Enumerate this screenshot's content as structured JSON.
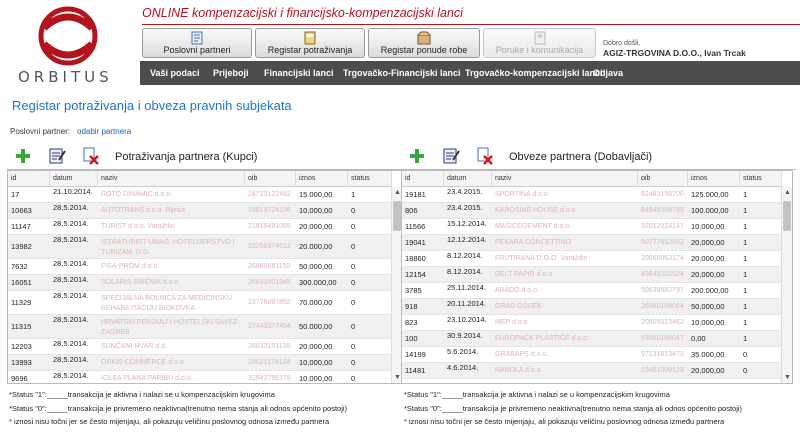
{
  "brand": {
    "logo_text": "ORBITUS",
    "logo_color": "#b3131c"
  },
  "app_title": "ONLINE kompenzacijski i financijsko-kompenzacijski lanci",
  "top_buttons": [
    {
      "label": "Poslovni partneri"
    },
    {
      "label": "Registar potraživanja"
    },
    {
      "label": "Registar ponude robe"
    },
    {
      "label": "Poruke i komunikacija"
    }
  ],
  "welcome": "Dobro došli,",
  "user": "AGIZ-TRGOVINA D.O.O., Ivan Trcak",
  "nav": [
    "Vaši podaci",
    "Prijeboji",
    "Financijski lanci",
    "Trgovačko-Financijski lanci",
    "Trgovačko-kompenzacijski lanci",
    "Odjava"
  ],
  "page_title": "Registar potraživanja i obveza pravnih subjekata",
  "partner": {
    "label": "Poslovni partner:",
    "link": "odabir partnera"
  },
  "columns": {
    "id": "id",
    "datum": "datum",
    "naziv": "naziv",
    "oib": "oib",
    "iznos": "iznos",
    "status": "status"
  },
  "left_panel": {
    "title": "Potraživanja partnera (Kupci)",
    "rows": [
      {
        "id": "17",
        "datum": "21.10.2014.",
        "naziv": "ROTO DINAMIC d.o.o.",
        "oib": "24723122482",
        "iznos": "15.000,00",
        "status": "1"
      },
      {
        "id": "10663",
        "datum": "28.5.2014.",
        "naziv": "AUTOTRANS d.o.o. Rijeka",
        "oib": "19819724156",
        "iznos": "10.000,00",
        "status": "0"
      },
      {
        "id": "11147",
        "datum": "28.5.2014.",
        "naziv": "TURIST d.o.o. Varaždin",
        "oib": "21819491065",
        "iznos": "20.000,00",
        "status": "0"
      },
      {
        "id": "13982",
        "datum": "28.5.2014.",
        "naziv": "ISTRATURIST UMAG, HOTELIJERSTVO I TURIZAM, D.D.",
        "oib": "22208374612",
        "iznos": "20.000,00",
        "status": "0"
      },
      {
        "id": "7632",
        "datum": "28.5.2014.",
        "naziv": "FISA-PROM d.o.o.",
        "oib": "26880061150",
        "iznos": "50.000,00",
        "status": "0"
      },
      {
        "id": "16051",
        "datum": "28.5.2014.",
        "naziv": "SOLARIS ŠIBENIK d.o.o.",
        "oib": "26833501945",
        "iznos": "300.000,00",
        "status": "0"
      },
      {
        "id": "11329",
        "datum": "28.5.2014.",
        "naziv": "SPECIJALNA BOLNICA ZA MEDICINSKU REHABILITACIJU BIOKOVKA",
        "oib": "23776097852",
        "iznos": "70.000,00",
        "status": "0"
      },
      {
        "id": "11315",
        "datum": "28.5.2014.",
        "naziv": "HRVATSKI PERJANJ I HOSTELSKI SAVEZ ZAGREB",
        "oib": "27443377404",
        "iznos": "50.000,00",
        "status": "0"
      },
      {
        "id": "12203",
        "datum": "28.5.2014.",
        "naziv": "SUNČANI HVAR d.d.",
        "oib": "28833151108",
        "iznos": "20.000,00",
        "status": "0"
      },
      {
        "id": "13993",
        "datum": "28.5.2014.",
        "naziv": "ORKIS COMMERCE d.o.o.",
        "oib": "29021178104",
        "iznos": "10.000,00",
        "status": "0"
      },
      {
        "id": "9696",
        "datum": "28.5.2014.",
        "naziv": "IGLBA PLANA PARIBU d.o.o.",
        "oib": "32942786178",
        "iznos": "10.000,00",
        "status": "0"
      }
    ]
  },
  "right_panel": {
    "title": "Obveze partnera (Dobavljači)",
    "rows": [
      {
        "id": "19181",
        "datum": "23.4.2015.",
        "naziv": "SPORTINA d.o.o.",
        "oib": "62483156700",
        "iznos": "125.000,00",
        "status": "1"
      },
      {
        "id": "806",
        "datum": "23.4.2015.",
        "naziv": "KAROSINE HOUSE d.o.o.",
        "oib": "84546008799",
        "iznos": "100.000,00",
        "status": "1"
      },
      {
        "id": "11566",
        "datum": "15.12.2014.",
        "naziv": "MAŠICEGEMENT d.o.o.",
        "oib": "32012024147",
        "iznos": "10.000,00",
        "status": "1"
      },
      {
        "id": "19041",
        "datum": "12.12.2014.",
        "naziv": "PEKARA CONCETTINO",
        "oib": "50777652592",
        "iznos": "20.000,00",
        "status": "1"
      },
      {
        "id": "18860",
        "datum": "8.12.2014.",
        "naziv": "FRUTIRANA D.O.O. Varaždin",
        "oib": "10060063174",
        "iznos": "20.000,00",
        "status": "1"
      },
      {
        "id": "12154",
        "datum": "8.12.2014.",
        "naziv": "DELT PAPIR d.o.o.",
        "oib": "43649202524",
        "iznos": "20.000,00",
        "status": "1"
      },
      {
        "id": "3785",
        "datum": "25.11.2014.",
        "naziv": "ABADO d.o.o.",
        "oib": "50630582797",
        "iznos": "200.000,00",
        "status": "1"
      },
      {
        "id": "918",
        "datum": "20.11.2014.",
        "naziv": "GRAD OSIJEK",
        "oib": "26060108064",
        "iznos": "50.000,00",
        "status": "1"
      },
      {
        "id": "823",
        "datum": "23.10.2014.",
        "naziv": "MEP d.o.o.",
        "oib": "20805013462",
        "iznos": "10.000,00",
        "status": "1"
      },
      {
        "id": "100",
        "datum": "30.9.2014.",
        "naziv": "EUROPACK PLASTIČE d.o.o.",
        "oib": "53560186047",
        "iznos": "0,00",
        "status": "1"
      },
      {
        "id": "14199",
        "datum": "5.6.2014.",
        "naziv": "GRABAPS d.o.o.",
        "oib": "97131613473",
        "iznos": "35.000,00",
        "status": "0"
      },
      {
        "id": "11481",
        "datum": "4.6.2014.",
        "naziv": "HANDLA d.o.o.",
        "oib": "13461009123",
        "iznos": "20.000,00",
        "status": "0"
      }
    ]
  },
  "notes": [
    "*Status \"1\":_____transakcija je aktivna i nalazi se u kompenzacijskim krugovima",
    "*Status \"0\":_____transakcija je privremeno neaktivna(trenutno nema stanja ali odnos općenito postoji)",
    "* iznosi nisu točni jer se često mijenjaju, ali pokazuju veličinu poslovnog odnosa između partnera"
  ]
}
